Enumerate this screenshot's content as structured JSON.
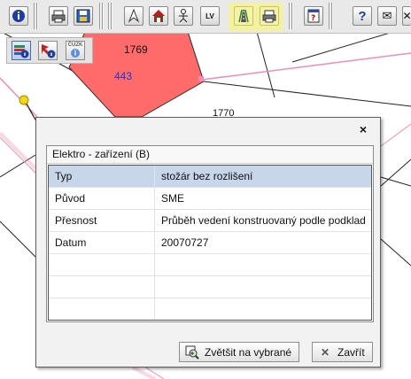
{
  "map": {
    "parcel_number": "1769",
    "parcel_sub_number": "443",
    "partial_label": "1770"
  },
  "toolbar": {
    "icons": [
      "info-icon",
      "print-icon",
      "export-icon",
      "north-arrow-icon",
      "home-icon",
      "person-icon",
      "lv-icon",
      "road-icon",
      "print-icon",
      "help-book-icon",
      "help-icon",
      "mail-icon",
      "close-icon"
    ],
    "lv_label": "LV",
    "help_label": "?",
    "mail_label": "✉",
    "close_label": "✕"
  },
  "subbar": {
    "cuzk_label": "ČÚZK"
  },
  "dialog": {
    "close_label": "×",
    "panel_title": "Elektro - zařízení (B)",
    "rows": [
      {
        "key": "Typ",
        "value": "stožár bez rozlišení"
      },
      {
        "key": "Původ",
        "value": "SME"
      },
      {
        "key": "Přesnost",
        "value": "Průběh vedení konstruovaný podle podklad"
      },
      {
        "key": "Datum",
        "value": "20070727"
      },
      {
        "key": "",
        "value": ""
      },
      {
        "key": "",
        "value": ""
      },
      {
        "key": "",
        "value": ""
      }
    ],
    "zoom_button": "Zvětšit na vybrané",
    "close_button": "Zavřít"
  },
  "colors": {
    "parcel_fill": "#ff6b6b",
    "selected_row": "#c8d6ea",
    "toolbar_highlight": "#f4f1a0",
    "boundary_pink": "#f08cb4",
    "marker_yellow": "#f2d80c"
  }
}
